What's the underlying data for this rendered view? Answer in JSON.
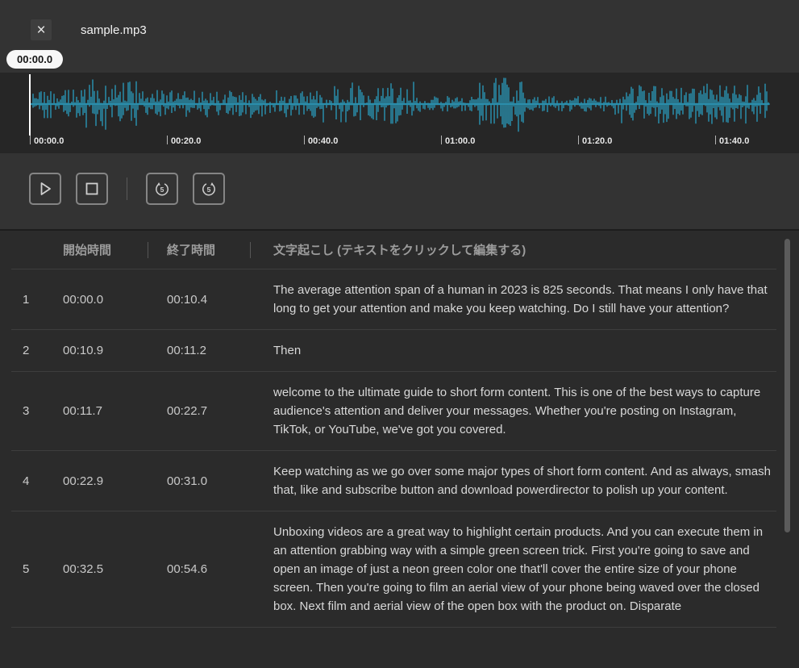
{
  "header": {
    "filename": "sample.mp3",
    "close_icon": "×"
  },
  "player": {
    "time_tooltip": "00:00.0",
    "rewind_seconds": "5",
    "forward_seconds": "5",
    "timeline": [
      "00:00.0",
      "00:20.0",
      "00:40.0",
      "01:00.0",
      "01:20.0",
      "01:40.0"
    ]
  },
  "table": {
    "col_start": "開始時間",
    "col_end": "終了時間",
    "col_text": "文字起こし (テキストをクリックして編集する)",
    "rows": [
      {
        "n": "1",
        "start": "00:00.0",
        "end": "00:10.4",
        "text": "The average attention span of a human in 2023 is 825 seconds. That means I only have that long to get your attention and make you keep watching. Do I still have your attention?"
      },
      {
        "n": "2",
        "start": "00:10.9",
        "end": "00:11.2",
        "text": "Then"
      },
      {
        "n": "3",
        "start": "00:11.7",
        "end": "00:22.7",
        "text": "welcome to the ultimate guide to short form content. This is one of the best ways to capture audience's attention and deliver your messages. Whether you're posting on Instagram, TikTok, or YouTube, we've got you covered."
      },
      {
        "n": "4",
        "start": "00:22.9",
        "end": "00:31.0",
        "text": "Keep watching as we go over some major types of short form content. And as always, smash that, like and subscribe button and download powerdirector to polish up your content."
      },
      {
        "n": "5",
        "start": "00:32.5",
        "end": "00:54.6",
        "text": "Unboxing videos are a great way to highlight certain products. And you can execute them in an attention grabbing way with a simple green screen trick. First you're going to save and open an image of just a neon green color one that'll cover the entire size of your phone screen. Then you're going to film an aerial view of your phone being waved over the closed box. Next film and aerial view of the open box with the product on. Disparate"
      }
    ]
  },
  "colors": {
    "waveform": "#2ba7cc",
    "playhead": "#ffffff"
  }
}
